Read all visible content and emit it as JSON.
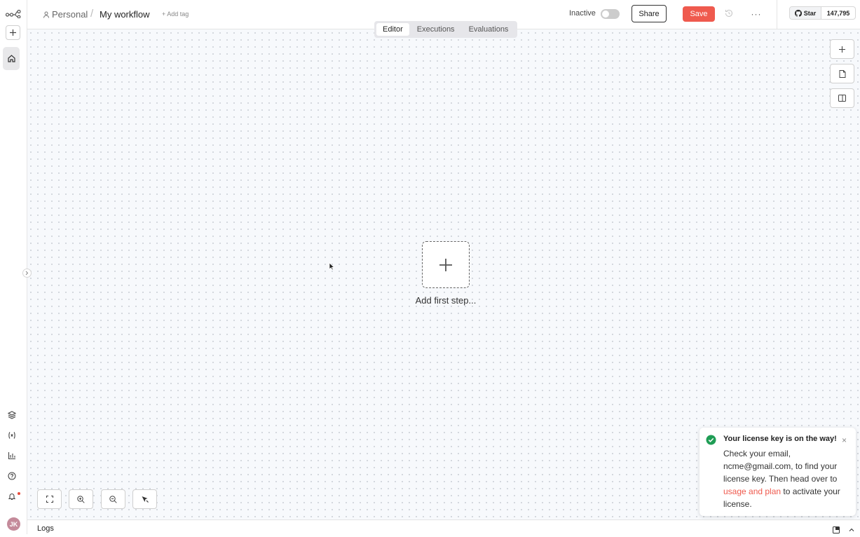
{
  "header": {
    "project": "Personal",
    "separator": "/",
    "workflow_name": "My workflow",
    "add_tag": "+ Add tag",
    "status": "Inactive",
    "share_label": "Share",
    "save_label": "Save",
    "more_label": "···"
  },
  "github": {
    "star_label": "Star",
    "star_count": "147,795"
  },
  "tabs": [
    {
      "label": "Editor",
      "active": true
    },
    {
      "label": "Executions",
      "active": false
    },
    {
      "label": "Evaluations",
      "active": false
    }
  ],
  "canvas": {
    "add_first_step": "Add first step..."
  },
  "user": {
    "initials": "JK"
  },
  "toast": {
    "title": "Your license key is on the way!",
    "body_before": "Check your email, ncme@gmail.com, to find your license key. Then head over to ",
    "link_text": "usage and plan",
    "body_after": " to activate your license.",
    "close": "×"
  },
  "logs": {
    "label": "Logs"
  },
  "colors": {
    "accent": "#ef5a4e",
    "success": "#1f9d55",
    "canvas_bg": "#f7f9fc"
  }
}
